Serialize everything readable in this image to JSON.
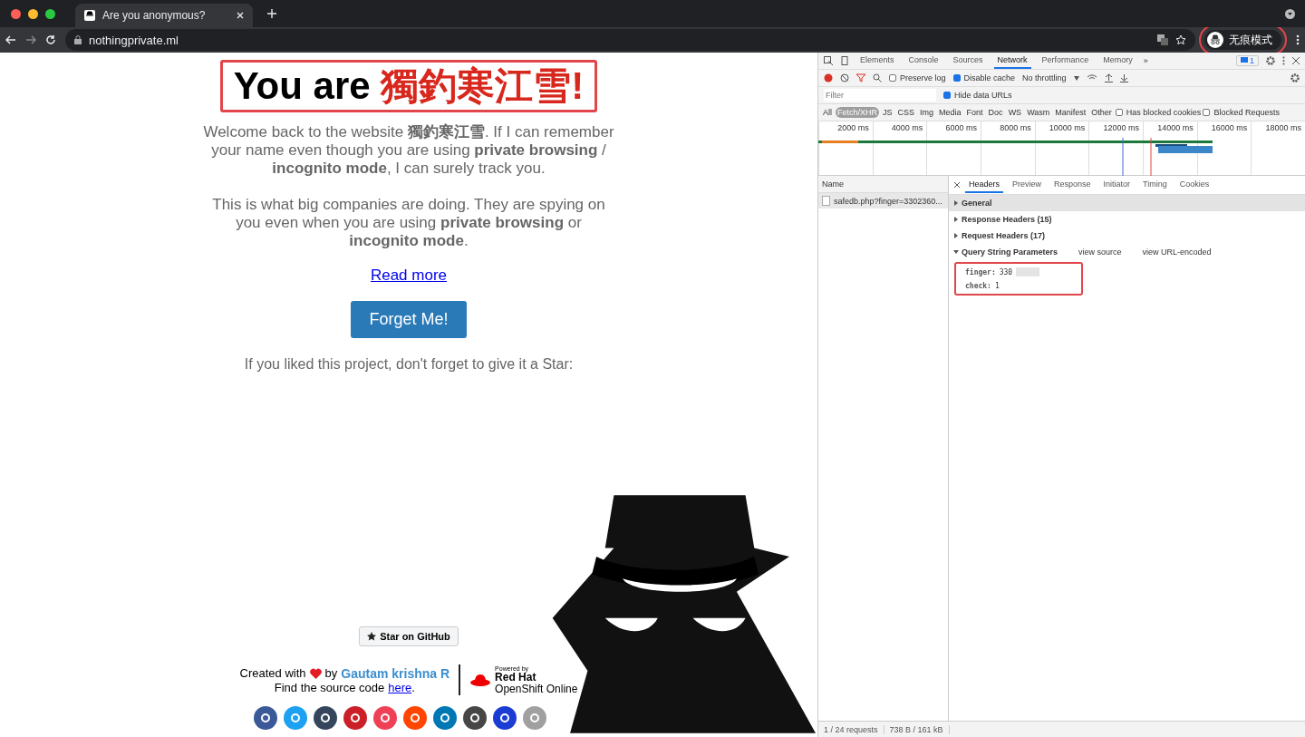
{
  "browser": {
    "tab_title": "Are you anonymous?",
    "url": "nothingprivate.ml",
    "profile_label": "无痕模式"
  },
  "page": {
    "title_prefix": "You are",
    "title_name": "獨釣寒江雪!",
    "paragraphs": [
      "Welcome back to the website **獨釣寒江雪**. If I can remember your name even though you are using **private browsing** / **incognito mode**, I can surely track you.",
      "This is what big companies are doing. They are spying on you even when you are using **private browsing** or **incognito mode**."
    ],
    "read_more": "Read more",
    "forget_button": "Forget Me!",
    "star_prompt": "If you liked this project, don't forget to give it a Star:",
    "github_button": "Star on GitHub",
    "created_with": "Created with",
    "by": "by",
    "author": "Gautam krishna R",
    "source_prefix": "Find the source code",
    "source_link": "here",
    "source_suffix": ".",
    "powered_by": "Powered by",
    "redhat": "Red Hat",
    "openshift": "OpenShift Online",
    "share_icons": [
      {
        "color": "#3b5998"
      },
      {
        "color": "#1da1f2"
      },
      {
        "color": "#35465c"
      },
      {
        "color": "#cb2027"
      },
      {
        "color": "#ef4056"
      },
      {
        "color": "#ff4500"
      },
      {
        "color": "#0077b5"
      },
      {
        "color": "#464646"
      },
      {
        "color": "#1b3dd4"
      },
      {
        "color": "#a0a0a0"
      }
    ]
  },
  "devtools": {
    "tabs": [
      {
        "label": "Elements",
        "selected": false
      },
      {
        "label": "Console",
        "selected": false
      },
      {
        "label": "Sources",
        "selected": false
      },
      {
        "label": "Network",
        "selected": true
      },
      {
        "label": "Performance",
        "selected": false
      },
      {
        "label": "Memory",
        "selected": false
      }
    ],
    "more": "»",
    "issues_count": "1",
    "preserve_log": {
      "label": "Preserve log",
      "checked": false
    },
    "disable_cache": {
      "label": "Disable cache",
      "checked": true
    },
    "throttling": "No throttling",
    "filter_placeholder": "Filter",
    "hide_data_urls": {
      "label": "Hide data URLs",
      "checked": true
    },
    "types": [
      {
        "label": "All",
        "selected": false
      },
      {
        "label": "Fetch/XHR",
        "selected": true
      },
      {
        "label": "JS",
        "selected": false
      },
      {
        "label": "CSS",
        "selected": false
      },
      {
        "label": "Img",
        "selected": false
      },
      {
        "label": "Media",
        "selected": false
      },
      {
        "label": "Font",
        "selected": false
      },
      {
        "label": "Doc",
        "selected": false
      },
      {
        "label": "WS",
        "selected": false
      },
      {
        "label": "Wasm",
        "selected": false
      },
      {
        "label": "Manifest",
        "selected": false
      },
      {
        "label": "Other",
        "selected": false
      }
    ],
    "has_blocked_cookies": {
      "label": "Has blocked cookies",
      "checked": false
    },
    "blocked_requests": {
      "label": "Blocked Requests",
      "checked": false
    },
    "timeline_ticks": [
      "2000 ms",
      "4000 ms",
      "6000 ms",
      "8000 ms",
      "10000 ms",
      "12000 ms",
      "14000 ms",
      "16000 ms",
      "18000 ms"
    ],
    "name_header": "Name",
    "requests": [
      {
        "name": "safedb.php?finger=3302360...",
        "selected": true
      }
    ],
    "detail_tabs": [
      {
        "label": "Headers",
        "selected": true
      },
      {
        "label": "Preview",
        "selected": false
      },
      {
        "label": "Response",
        "selected": false
      },
      {
        "label": "Initiator",
        "selected": false
      },
      {
        "label": "Timing",
        "selected": false
      },
      {
        "label": "Cookies",
        "selected": false
      }
    ],
    "sections": [
      {
        "title": "General",
        "expanded": false
      },
      {
        "title": "Response Headers (15)",
        "expanded": false
      },
      {
        "title": "Request Headers (17)",
        "expanded": false
      },
      {
        "title": "Query String Parameters",
        "expanded": true,
        "links": [
          "view source",
          "view URL-encoded"
        ],
        "params": [
          {
            "key": "finger:",
            "value": "330",
            "blurred": true
          },
          {
            "key": "check:",
            "value": "1",
            "blurred": false
          }
        ]
      }
    ],
    "status": [
      "1 / 24 requests",
      "738 B / 161 kB"
    ]
  }
}
